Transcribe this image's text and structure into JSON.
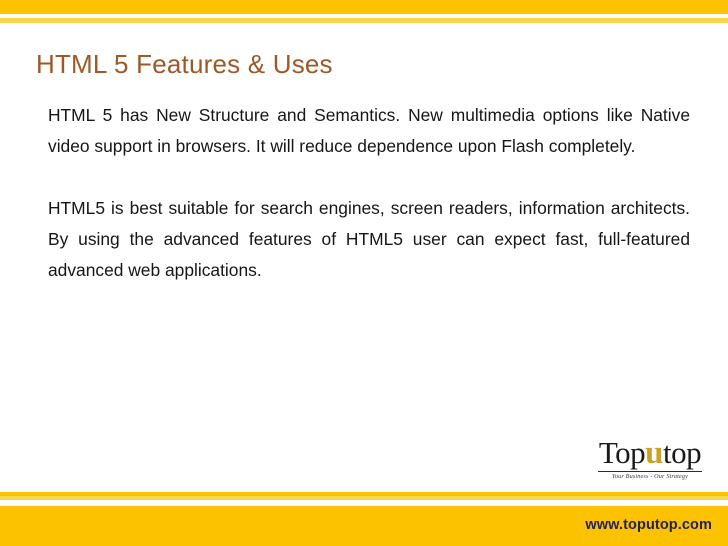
{
  "slide": {
    "title": "HTML 5 Features & Uses",
    "paragraphs": [
      "HTML 5 has New Structure and Semantics. New multimedia options like Native video support in browsers. It will reduce dependence upon Flash completely.",
      "HTML5 is best suitable for search engines, screen readers, information architects. By using the advanced features of HTML5 user can expect fast, full-featured advanced web applications."
    ]
  },
  "logo": {
    "text_before": "Top",
    "text_highlight": "u",
    "text_after": "top",
    "tagline": "Your Business - Our Strategy"
  },
  "footer": {
    "url": "www.toputop.com"
  },
  "colors": {
    "band_primary": "#fcc200",
    "band_secondary": "#f7d64a",
    "title": "#9d5927",
    "body_text": "#161616",
    "url_text": "#23235c",
    "logo_highlight": "#c9a227"
  }
}
